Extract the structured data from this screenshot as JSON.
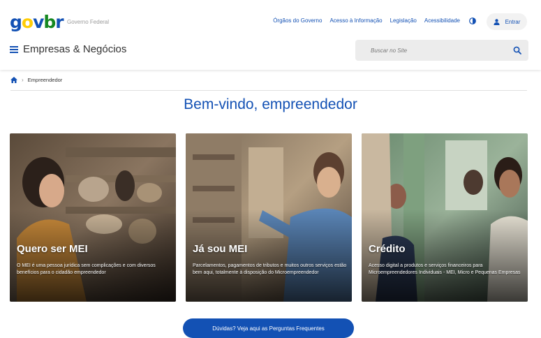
{
  "header": {
    "logo": {
      "g": "g",
      "o": "o",
      "v": "v",
      "b": "b",
      "r": "r"
    },
    "gov_label": "Governo Federal",
    "links": [
      "Órgãos do Governo",
      "Acesso à Informação",
      "Legislação",
      "Acessibilidade"
    ],
    "login_label": "Entrar",
    "site_title": "Empresas & Negócios",
    "search_placeholder": "Buscar no Site"
  },
  "breadcrumb": {
    "current": "Empreendedor"
  },
  "main": {
    "title": "Bem-vindo, empreendedor",
    "cards": [
      {
        "title": "Quero ser MEI",
        "desc": "O MEI é uma pessoa jurídica sem complicações e com diversos benefícios para o cidadão empreendedor"
      },
      {
        "title": "Já sou MEI",
        "desc": "Parcelamentos, pagamentos de tributos e muitos outros serviços estão bem aqui, totalmente à disposição do Microempreendedor"
      },
      {
        "title": "Crédito",
        "desc": "Acesso digital a produtos e serviços financeiros para Microempreendedores Individuais - MEI, Micro e Pequenas Empresas"
      }
    ],
    "faq_button": "Dúvidas? Veja aqui as Perguntas Frequentes"
  },
  "colors": {
    "primary": "#1351b4",
    "gov_yellow": "#ffcd07",
    "gov_green": "#168821"
  },
  "icons": [
    "contrast-icon",
    "user-icon",
    "menu-icon",
    "search-icon",
    "home-icon"
  ]
}
